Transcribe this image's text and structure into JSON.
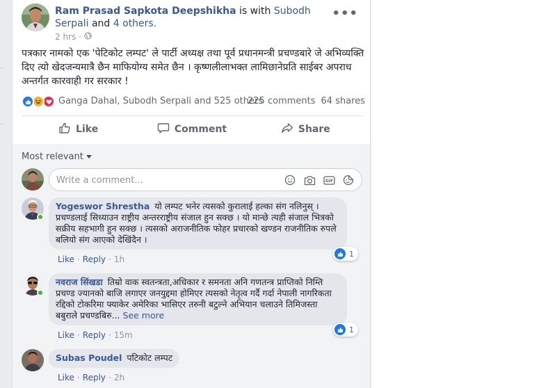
{
  "post": {
    "author": "Ram Prasad Sapkota Deepshikha",
    "with_text": "is with",
    "tagged": "Subodh Serpali",
    "and_text": "and",
    "others": "4 others.",
    "time": "2 hrs",
    "privacy_icon": "globe-icon",
    "text": "पत्रकार नामको एक 'पेटिकोट लम्पट' ले पार्टी अध्यक्ष तथा पूर्व प्रधानमन्त्री प्रचण्डबारे जे अभिव्यक्ति दिए त्यो खेदजन्यमात्रै छैन माफियोग्य समेत छैन । कृष्णलीलाभक्त लामिछानेप्रति साईबर अपराध अन्तर्गत कारवाही गर सरकार !",
    "reaction_names": "Ganga Dahal, Subodh Serpali and 525 others",
    "comments_count": "225 comments",
    "shares_count": "64 shares"
  },
  "actions": {
    "like": "Like",
    "comment": "Comment",
    "share": "Share"
  },
  "comments_section": {
    "sort_label": "Most relevant",
    "placeholder": "Write a comment...",
    "comments": [
      {
        "name": "Yogeswor Shrestha",
        "text": "यो लम्पट भनेर त्यसको कुरालाई हल्का संग नलिनुस् । प्रचण्डलाई सिध्याउन राष्ट्रीय अन्तरराष्ट्रीय संजाल हुन सक्छ । यो मान्छे त्यही संजाल भित्रको सक्रीय सहभागी हुन सक्छ । त्यसको अराजनीतिक फोहर प्रचारको खण्डन राजनीतिक रुपले बलियो संग आएको देखिंदैन ।",
        "like": "Like",
        "reply": "Reply",
        "time": "1h",
        "likes": "1"
      },
      {
        "name": "नवराज सिंखडा",
        "text": "तिम्रो वाक स्वतन्त्रता,अधिकार र समनता अनि गणतन्त्र प्राप्तिको निम्ति प्रचण्ड ज्यानको बाजि लगाएर जनयुद्दमा होमिएर त्यसको नेतृत्व गर्दै गर्दा नेपाली नागरिकता रद्दिको टोकरिमा फ्याकेर अमेरिका भासिएर तरुनी बटुल्ने अभियान चलाउने तिमिजस्ता बबुराले प्रचण्डबिरु...",
        "see_more": "See more",
        "like": "Like",
        "reply": "Reply",
        "time": "15m",
        "likes": "1"
      },
      {
        "name": "Subas Poudel",
        "text": "पटिकोट लम्पट",
        "like": "Like",
        "reply": "Reply",
        "time": "2h"
      }
    ]
  },
  "colors": {
    "link": "#385898",
    "like_blue": "#1877f2",
    "online_green": "#42b72a",
    "bubble_bg": "#e4e6eb"
  }
}
